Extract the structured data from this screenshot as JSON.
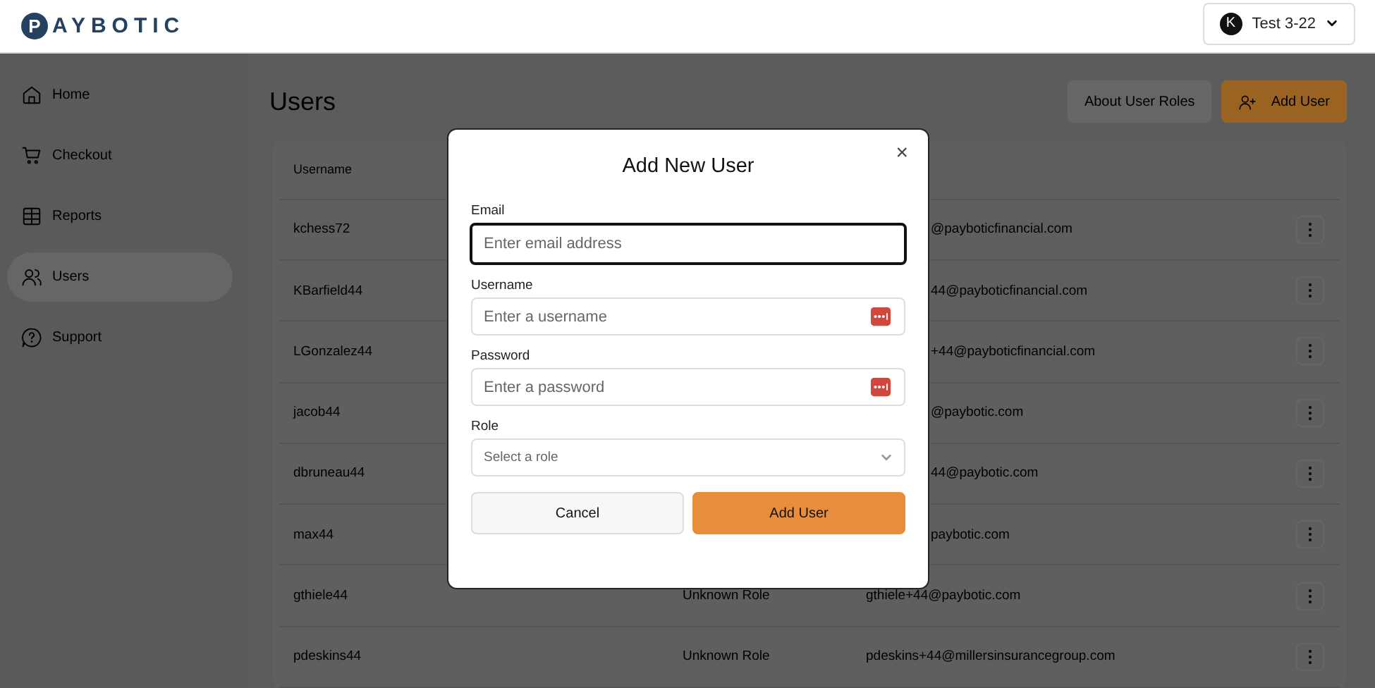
{
  "header": {
    "logo_mark": "P",
    "logo_text": "AYBOTIC",
    "account": {
      "initial": "K",
      "name": "Test 3-22"
    }
  },
  "sidebar": {
    "items": [
      {
        "label": "Home",
        "selected": false
      },
      {
        "label": "Checkout",
        "selected": false
      },
      {
        "label": "Reports",
        "selected": false
      },
      {
        "label": "Users",
        "selected": true
      },
      {
        "label": "Support",
        "selected": false
      }
    ]
  },
  "page": {
    "title": "Users",
    "buttons": [
      {
        "label": "About User Roles",
        "kind": "secondary"
      },
      {
        "label": "Add User",
        "kind": "primary"
      }
    ]
  },
  "table": {
    "columns": [
      "Username"
    ],
    "rows": [
      {
        "username": "kchess72",
        "email": "@payboticfinancial.com"
      },
      {
        "username": "KBarfield44",
        "email": "44@payboticfinancial.com"
      },
      {
        "username": "LGonzalez44",
        "email": "+44@payboticfinancial.com"
      },
      {
        "username": "jacob44",
        "email": "@paybotic.com"
      },
      {
        "username": "dbruneau44",
        "email": "44@paybotic.com"
      },
      {
        "username": "max44",
        "email": "paybotic.com"
      },
      {
        "username": "gthiele44",
        "role": "Unknown Role",
        "email": "gthiele+44@paybotic.com"
      },
      {
        "username": "pdeskins44",
        "role": "Unknown Role",
        "email": "pdeskins+44@millersinsurancegroup.com"
      }
    ]
  },
  "modal": {
    "title": "Add New User",
    "close": "×",
    "fields": [
      {
        "label": "Email",
        "kind": "text",
        "placeholder": "Enter email address",
        "focused": true
      },
      {
        "label": "Username",
        "kind": "key",
        "placeholder": "Enter a username",
        "focused": false
      },
      {
        "label": "Password",
        "kind": "key",
        "placeholder": "Enter a password",
        "focused": false
      },
      {
        "label": "Role",
        "kind": "select",
        "placeholder": "Select a role",
        "focused": false
      }
    ],
    "buttons": [
      {
        "label": "Cancel",
        "kind": "secondary"
      },
      {
        "label": "Add User",
        "kind": "primary"
      }
    ]
  }
}
